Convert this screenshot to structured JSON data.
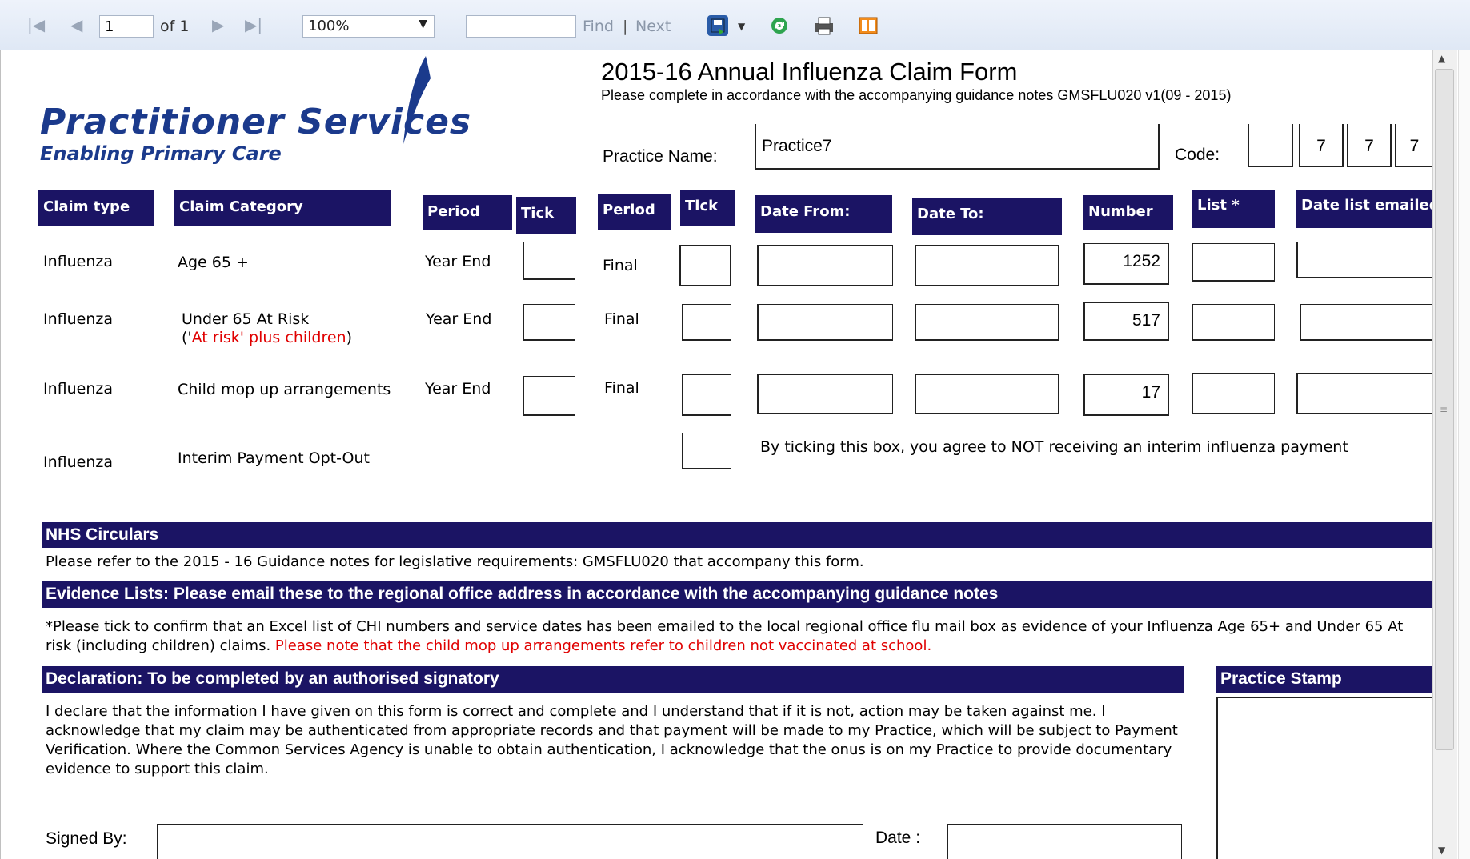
{
  "toolbar": {
    "page_value": "1",
    "page_of": "of 1",
    "zoom_value": "100%",
    "find_placeholder": "",
    "find_label": "Find",
    "separator": "|",
    "next_label": "Next",
    "icons": [
      "first-page-icon",
      "previous-page-icon",
      "next-page-icon",
      "last-page-icon",
      "export-save-icon",
      "refresh-icon",
      "print-icon",
      "document-map-icon"
    ]
  },
  "logo": {
    "line1": "Practitioner Services",
    "line2": "Enabling Primary Care",
    "color": "#1b3a8c"
  },
  "form": {
    "title": "2015-16 Annual Influenza Claim Form",
    "subtitle": "Please complete in accordance with the accompanying guidance notes GMSFLU020 v1(09 - 2015)",
    "practice_name_label": "Practice Name:",
    "practice_name_value": "Practice7",
    "code_label": "Code:",
    "code_digits": [
      "",
      "7",
      "7",
      "7"
    ]
  },
  "table": {
    "headers": {
      "claim_type": "Claim type",
      "claim_category": "Claim Category",
      "period1": "Period",
      "tick1": "Tick",
      "period2": "Period",
      "tick2": "Tick",
      "date_from": "Date From:",
      "date_to": "Date To:",
      "number": "Number",
      "list": "List *",
      "date_list_emailed": "Date list emailed"
    },
    "rows": [
      {
        "type": "Influenza",
        "category": "Age 65 +",
        "category_note_open": "",
        "category_note_red": "",
        "category_note_close": "",
        "period1": "Year End",
        "period2": "Final",
        "number": "1252"
      },
      {
        "type": "Influenza",
        "category": "Under 65 At Risk",
        "category_note_open": "('",
        "category_note_red": "At risk' plus children",
        "category_note_close": ")",
        "period1": "Year End",
        "period2": "Final",
        "number": "517"
      },
      {
        "type": "Influenza",
        "category": "Child mop up arrangements",
        "category_note_open": "",
        "category_note_red": "",
        "category_note_close": "",
        "period1": "Year End",
        "period2": "Final",
        "number": "17"
      },
      {
        "type": "Influenza",
        "category": "Interim Payment Opt-Out",
        "optout_text": "By ticking this box, you agree to NOT receiving an interim influenza payment"
      }
    ]
  },
  "circulars": {
    "heading": "NHS Circulars",
    "text": "Please refer to the 2015 - 16 Guidance notes for legislative requirements: GMSFLU020 that accompany this form."
  },
  "evidence": {
    "heading": "Evidence Lists: Please email these to the regional office address in accordance with the accompanying guidance notes",
    "text_black": "*Please tick to confirm that an Excel list of CHI numbers and service dates has been emailed to the local regional office flu mail box as evidence of your Influenza Age 65+ and Under 65 At risk (including children) claims.",
    "text_red": "Please note that the child mop up arrangements refer to children not vaccinated at school."
  },
  "declaration": {
    "heading": "Declaration: To be completed by an authorised signatory",
    "text": "I declare that the information I have given on this form is correct and complete and I understand that if it is not, action may be taken against me. I acknowledge that my claim may be authenticated from appropriate records and that payment will be made to my Practice, which will be subject to Payment Verification. Where the Common Services Agency is unable to obtain authentication, I acknowledge that the onus is on my Practice to provide documentary evidence to support this claim.",
    "signed_by_label": "Signed By:",
    "date_label": "Date :"
  },
  "stamp": {
    "heading": "Practice Stamp"
  },
  "colors": {
    "navy": "#1b1464",
    "red": "#e00000"
  }
}
